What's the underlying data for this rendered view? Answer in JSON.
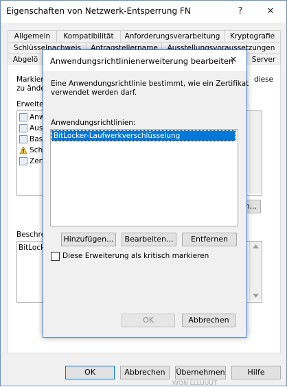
{
  "outer_dialog": {
    "title": "Eigenschaften von Netzwerk-Entsperrung FN",
    "help_glyph": "?",
    "close_glyph": "✕",
    "tabs_row1": [
      "Allgemein",
      "Kompatibilität",
      "Anforderungsverarbeitung",
      "Kryptografie"
    ],
    "tabs_row2": [
      "Schlüsselnachweis",
      "Antragstellername",
      "Ausstellungsvoraussetzungen"
    ],
    "tabs_row3_left": "Abgelö",
    "tabs_row3_right": "Server",
    "desc_line1": "Markiere",
    "desc_line1_right": "diese",
    "desc_line2": "zu änder",
    "extensions_label": "Erweiter",
    "extension_items": [
      "Anwe",
      "Auss",
      "Basi",
      "Schl",
      "Zert"
    ],
    "edit_button_partial": "n...",
    "description_label": "Beschre",
    "description_value": "BitLock",
    "buttons": {
      "ok": "OK",
      "cancel": "Abbrechen",
      "apply": "Übernehmen",
      "help": "Hilfe"
    },
    "bottom_fragment": "WON LLLUUUT"
  },
  "inner_dialog": {
    "title": "Anwendungsrichtlinienerweiterung bearbeiten",
    "close_glyph": "✕",
    "description": [
      "Eine Anwendungsrichtlinie bestimmt, wie ein Zertifikat",
      "verwendet werden darf."
    ],
    "list_label": "Anwendungsrichtlinien:",
    "policies": [
      "BitLocker-Laufwerkverschlüsselung"
    ],
    "buttons": {
      "add": "Hinzufügen...",
      "edit": "Bearbeiten...",
      "remove": "Entfernen",
      "ok": "OK",
      "cancel": "Abbrechen"
    },
    "critical_checkbox_label": "Diese Erweiterung als kritisch markieren",
    "critical_checked": false
  }
}
